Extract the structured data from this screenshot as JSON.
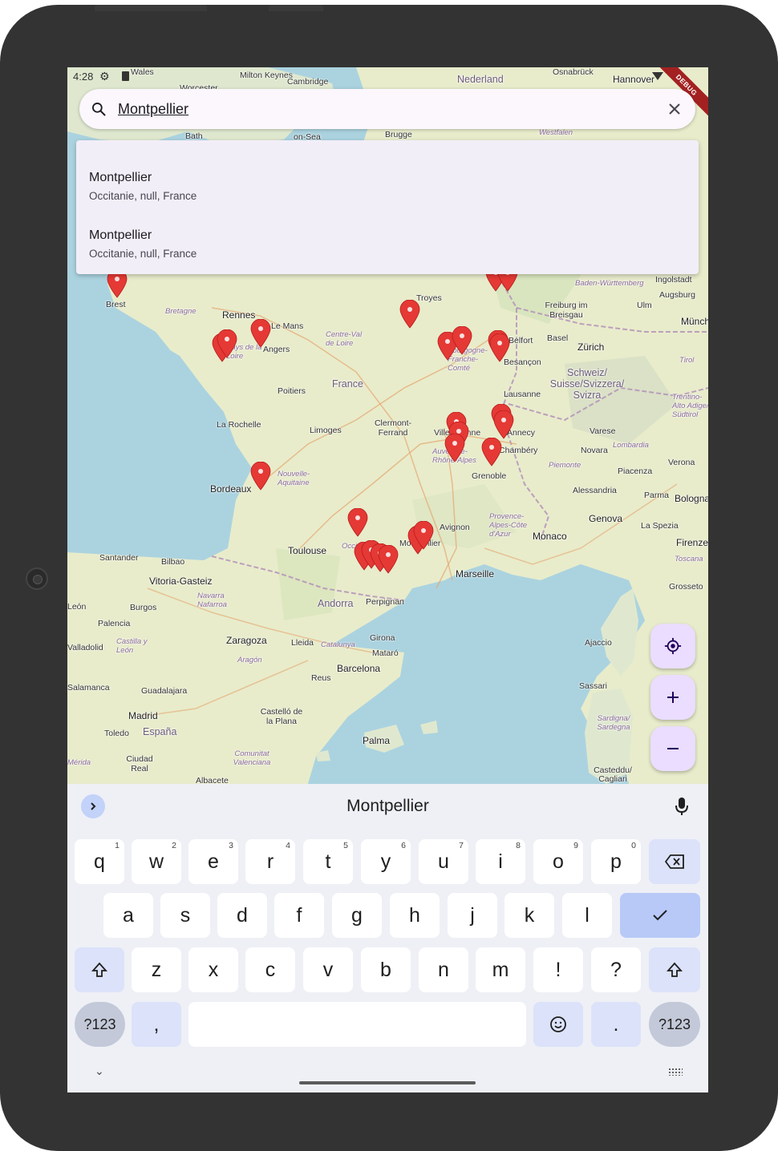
{
  "status": {
    "time": "4:28",
    "debug_banner": "DEBUG"
  },
  "search": {
    "query": "Montpellier",
    "icon": "search-icon",
    "clear_icon": "close-icon"
  },
  "suggestions": [
    {
      "title": "Montpellier",
      "subtitle": "Occitanie, null, France"
    },
    {
      "title": "Montpellier",
      "subtitle": "Occitanie, null, France"
    }
  ],
  "map": {
    "places": [
      "Wales",
      "Milton Keynes",
      "Cambridge",
      "Worcester",
      "Nederland",
      "Osnabrück",
      "Hannover",
      "Bath",
      "on-Sea",
      "Brugge",
      "Westfalen",
      "Brest",
      "Bretagne",
      "Rennes",
      "Le Mans",
      "Angers",
      "Pays de la Loire",
      "Centre-Val de Loire",
      "Troyes",
      "Bourgogne-Franche-Comté",
      "Belfort",
      "Besançon",
      "Baden-Württemberg",
      "Ingolstadt",
      "Augsburg",
      "Freiburg im Breisgau",
      "Ulm",
      "Basel",
      "Zürich",
      "München",
      "Tirol",
      "Schweiz/ Suisse/Svizzera/ Svizra",
      "Lausanne",
      "Trentino-Alto Adige/ Südtirol",
      "France",
      "Poitiers",
      "La Rochelle",
      "Limoges",
      "Clermont-Ferrand",
      "Villeurbanne",
      "Annecy",
      "Varese",
      "Lombardia",
      "Auvergne-Rhône-Alpes",
      "Chambéry",
      "Novara",
      "Verona",
      "Piemonte",
      "Piacenza",
      "Grenoble",
      "Nouvelle-Aquitaine",
      "Bordeaux",
      "Alessandria",
      "Parma",
      "Bologna",
      "Provence-Alpes-Côte d'Azur",
      "Genova",
      "Avignon",
      "Monaco",
      "La Spezia",
      "Toulouse",
      "Occitanie",
      "Montpellier",
      "Firenze",
      "Toscana",
      "Santander",
      "Bilbao",
      "Marseille",
      "Vitoria-Gasteiz",
      "Grosseto",
      "Navarra Nafarroa",
      "Andorra",
      "Perpignan",
      "León",
      "Burgos",
      "Palencia",
      "Zaragoza",
      "Lleida",
      "Catalunya",
      "Ajaccio",
      "Valladolid",
      "Castilla y León",
      "Girona",
      "Mataró",
      "Aragón",
      "Barcelona",
      "Reus",
      "Sassari",
      "Salamanca",
      "Guadalajara",
      "Madrid",
      "Castelló de la Plana",
      "Sardigna/ Sardegna",
      "Toledo",
      "España",
      "Palma",
      "Ciudad Real",
      "Comunitat Valenciana",
      "Albacete",
      "Casteddu/ Cagliari",
      "Mérida"
    ],
    "marker_icon": "map-marker-icon",
    "marker_color": "#e53935"
  },
  "fabs": {
    "locate_icon": "my-location-icon",
    "zoom_in_icon": "plus-icon",
    "zoom_out_icon": "minus-icon",
    "color": "#eaddff"
  },
  "keyboard": {
    "suggestion": "Montpellier",
    "row1": [
      {
        "key": "q",
        "hint": "1"
      },
      {
        "key": "w",
        "hint": "2"
      },
      {
        "key": "e",
        "hint": "3"
      },
      {
        "key": "r",
        "hint": "4"
      },
      {
        "key": "t",
        "hint": "5"
      },
      {
        "key": "y",
        "hint": "6"
      },
      {
        "key": "u",
        "hint": "7"
      },
      {
        "key": "i",
        "hint": "8"
      },
      {
        "key": "o",
        "hint": "9"
      },
      {
        "key": "p",
        "hint": "0"
      }
    ],
    "row2": [
      "a",
      "s",
      "d",
      "f",
      "g",
      "h",
      "j",
      "k",
      "l"
    ],
    "row3": [
      "z",
      "x",
      "c",
      "v",
      "b",
      "n",
      "m",
      "!",
      "?"
    ],
    "symbols_label": "?123",
    "comma": ",",
    "period": ".",
    "accent_color": "#b8c9f7"
  }
}
